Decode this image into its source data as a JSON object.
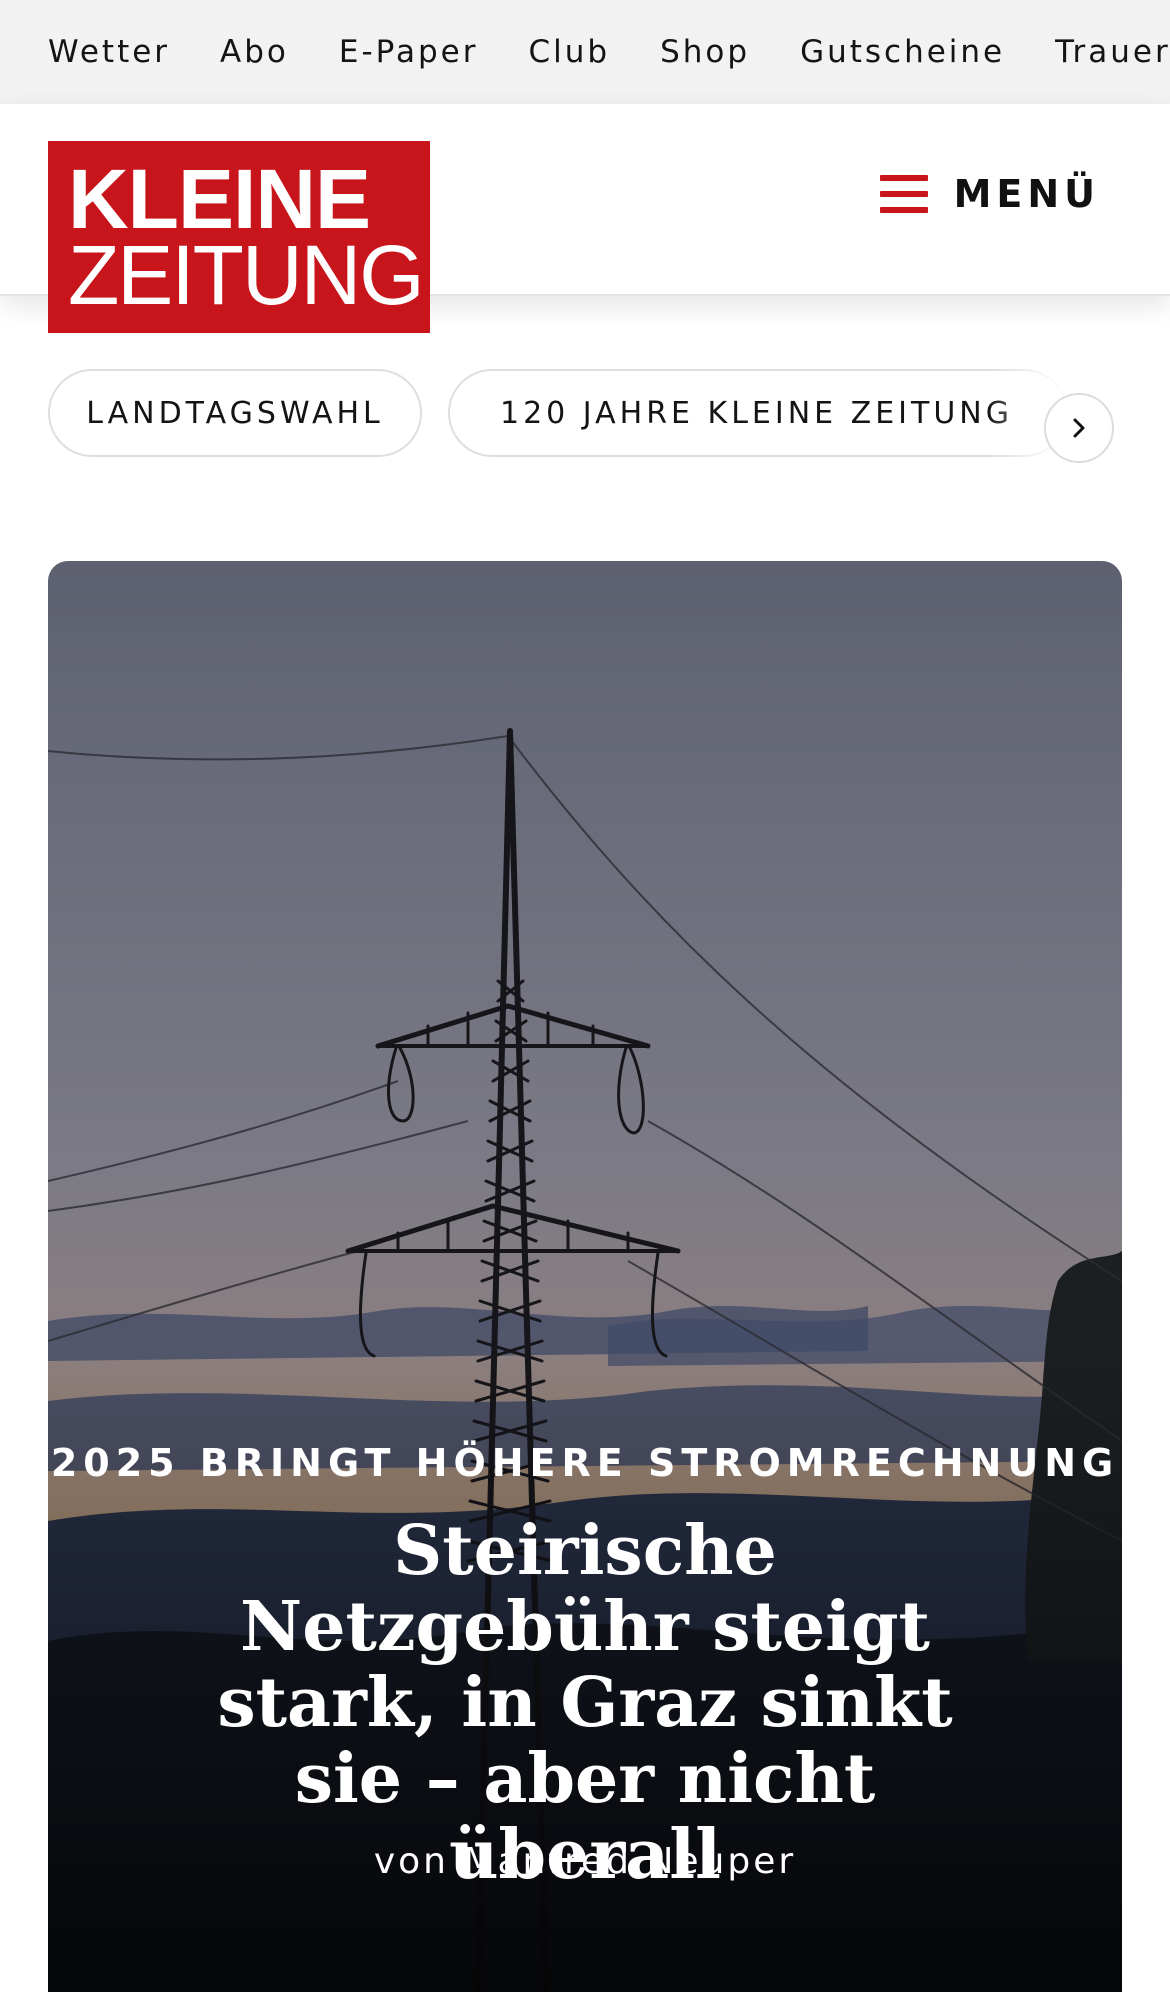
{
  "topnav": {
    "links": [
      "Wetter",
      "Abo",
      "E-Paper",
      "Club",
      "Shop",
      "Gutscheine",
      "Trauerp"
    ]
  },
  "logo": {
    "line1": "KLEINE",
    "line2": "ZEITUNG"
  },
  "header": {
    "menu_label": "MENÜ",
    "menu_icon": "hamburger-icon"
  },
  "topics": {
    "pills": [
      "LANDTAGSWAHL",
      "120 JAHRE KLEINE ZEITUNG"
    ],
    "next_icon": "chevron-right-icon"
  },
  "hero": {
    "kicker": "2025 BRINGT HÖHERE STROMRECHNUNG",
    "headline": "Steirische Netzgebühr steigt stark, in Graz sinkt sie – aber nicht überall",
    "author": "von Manfred Neuper"
  },
  "colors": {
    "brand_red": "#c8151b",
    "topbar_bg": "#f2f2f2"
  }
}
